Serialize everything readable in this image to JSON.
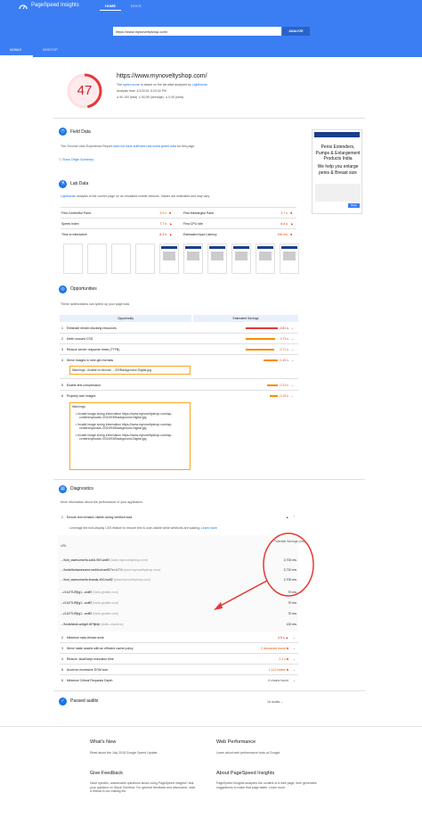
{
  "header": {
    "app_name": "PageSpeed Insights",
    "nav_home": "HOME",
    "nav_docs": "DOCS",
    "url_value": "https://www.mynoveltyshop.com/",
    "analyze_label": "ANALYZE"
  },
  "tabs": {
    "mobile": "MOBILE",
    "desktop": "DESKTOP"
  },
  "summary": {
    "score": "47",
    "score_fraction": 0.47,
    "page_url": "https://www.mynoveltyshop.com/",
    "speed_pre": "The ",
    "speed_link": "speed score",
    "speed_mid": " is based on the lab data analyzed by ",
    "lighthouse": "Lighthouse",
    "analysis_time": "Analysis time: 4/1/2019, 5:23:32 PM",
    "legend_fast": "90-100 (fast)",
    "legend_avg": "50-89 (average)",
    "legend_slow": "0-49 (slow)"
  },
  "field": {
    "title": "Field Data",
    "text_pre": "The Chrome User Experience Report ",
    "text_link": "does not have sufficient real-world speed data",
    "text_post": " for this page.",
    "origin_btn": "Show Origin Summary"
  },
  "ad": {
    "headline": "Penis Extenders, Pumps & Enlargement Products India",
    "sub": "We help you enlarge penis & Breast size",
    "btn": "Shop"
  },
  "lab": {
    "title": "Lab Data",
    "desc_link": "Lighthouse",
    "desc": " analysis of the current page on an emulated mobile network. Values are estimated and may vary.",
    "metrics": [
      {
        "label": "First Contentful Paint",
        "value": "3.9 s"
      },
      {
        "label": "Speed Index",
        "value": "7.7 s"
      },
      {
        "label": "Time to Interactive",
        "value": "8.3 s"
      },
      {
        "label": "First Meaningful Paint",
        "value": "3.7 s"
      },
      {
        "label": "First CPU Idle",
        "value": "6.4 s"
      },
      {
        "label": "Estimated Input Latency",
        "value": "160 ms"
      }
    ]
  },
  "opportunities": {
    "title": "Opportunities",
    "desc": "These optimizations can speed up your page load.",
    "col_opp": "Opportunity",
    "col_save": "Estimated Savings",
    "rows": [
      {
        "n": "1",
        "label": "Eliminate render-blocking resources",
        "save": "0.81 s"
      },
      {
        "n": "2",
        "label": "Defer unused CSS",
        "save": "0.73 s"
      },
      {
        "n": "3",
        "label": "Reduce server response times (TTFB)",
        "save": "0.71 s"
      },
      {
        "n": "4",
        "label": "Serve images in next-gen formats",
        "save": "0.45 s"
      },
      {
        "n": "5",
        "label": "Enable text compression",
        "save": "0.23 s"
      },
      {
        "n": "6",
        "label": "Properly size images",
        "save": "0.15 s"
      }
    ],
    "warn1": "Warnings: Unable to decode .../03/Background-Digital.jpg",
    "warn2_title": "Warnings:",
    "warn2_items": [
      "Invalid image sizing information https://www.mynoveltyshop.com/wp-content/uploads /2019/03/Background-Digital.jpg",
      "Invalid image sizing information https://www.mynoveltyshop.com/wp-content/uploads /2019/03/Background-Digital.jpg",
      "Invalid image sizing information https://www.mynoveltyshop.com/wp-content/uploads /2019/03/Background-Digital.jpg"
    ]
  },
  "diagnostics": {
    "title": "Diagnostics",
    "desc": "More information about the performance of your application.",
    "d1": "Ensure text remains visible during webfont load",
    "d1_desc": "Leverage the font-display CSS feature to ensure text is user-visible while webfonts are loading.",
    "learn_more": "Learn more",
    "col_url": "URL",
    "col_save": "Potential Savings (ms)",
    "urls": [
      {
        "u": ".../font_awesome/fa-solid-900.woff2",
        "h": "(www.mynoveltyshop.com)",
        "v": "2,700 ms"
      },
      {
        "u": ".../fonts/fontawesome-webfont.woff2?v=4.7.0",
        "h": "(www.mynoveltyshop.com)",
        "v": "2,710 ms"
      },
      {
        "u": ".../font_awesome/fa-brands-400.woff2",
        "h": "(www.mynoveltyshop.com)",
        "v": "2,700 ms"
      },
      {
        "u": "...v13/JTURjIg1...woff2",
        "h": "(fonts.gstatic.com)",
        "v": "70 ms"
      },
      {
        "u": "...v13/JTURjIg1...woff2",
        "h": "(fonts.gstatic.com)",
        "v": "70 ms"
      },
      {
        "u": "...v13/JTURjIg1...woff2",
        "h": "(fonts.gstatic.com)",
        "v": "70 ms"
      },
      {
        "u": ".../fonts/tawk-widget.ttf?fjeejr",
        "h": "(static-v.tawk.to)",
        "v": "120 ms"
      }
    ],
    "rows": [
      {
        "n": "2",
        "label": "Minimize main-thread work",
        "val": "4.5 s"
      },
      {
        "n": "3",
        "label": "Serve static assets with an efficient cache policy",
        "val": "2 resources found"
      },
      {
        "n": "4",
        "label": "Reduce JavaScript execution time",
        "val": "2.1 s"
      },
      {
        "n": "5",
        "label": "Avoid an excessive DOM size",
        "val": "1,112 nodes"
      },
      {
        "n": "6",
        "label": "Minimize Critical Requests Depth",
        "val": "6 chains found"
      }
    ]
  },
  "passed": {
    "title": "Passed audits",
    "count": "16 audits"
  },
  "footer": {
    "whats_new": "What's New",
    "whats_new_t": "Read about the July 2018 Google Speed Update.",
    "web_perf": "Web Performance",
    "web_perf_t": "Learn about web performance tools at Google.",
    "feedback": "Give Feedback",
    "feedback_t": "Have specific, answerable questions about using PageSpeed Insights? Ask your question on Stack Overflow. For general feedback and discussion, start a thread in our mailing list.",
    "about": "About PageSpeed Insights",
    "about_t": "PageSpeed Insights analyzes the content of a web page, then generates suggestions to make that page faster. Learn more."
  },
  "colors": {
    "brand": "#3b7ef4",
    "slow": "#c62828",
    "avg": "#e65100"
  }
}
